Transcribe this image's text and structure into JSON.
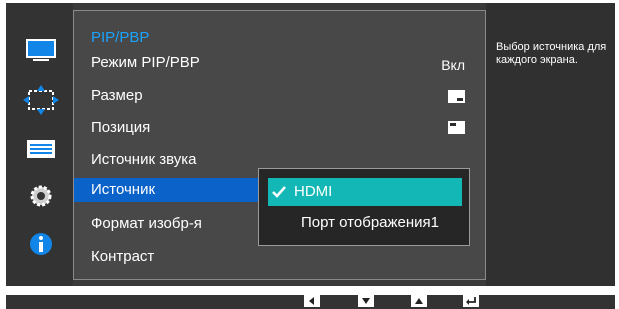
{
  "menu": {
    "title": "PIP/PBP",
    "items": [
      {
        "label": "Режим PIP/PBP"
      },
      {
        "label": "Размер"
      },
      {
        "label": "Позиция"
      },
      {
        "label": "Источник звука"
      },
      {
        "label": "Источник"
      },
      {
        "label": "Формат изобр-я"
      },
      {
        "label": "Контраст"
      }
    ],
    "mode_value": "Вкл"
  },
  "submenu": {
    "options": [
      {
        "label": "HDMI",
        "selected": true
      },
      {
        "label": "Порт отображения1",
        "selected": false
      }
    ]
  },
  "help": {
    "text": "Выбор источника для каждого экрана."
  },
  "sidebar": {
    "icons": [
      "picture-icon",
      "size-position-icon",
      "system-icon",
      "settings-icon",
      "information-icon"
    ]
  },
  "footer": {
    "buttons": [
      "left-arrow-icon",
      "down-arrow-icon",
      "up-arrow-icon",
      "enter-icon"
    ]
  },
  "colors": {
    "accent_blue": "#1aa3ff",
    "selected_row": "#0b62c8",
    "selected_option": "#13b8b6"
  }
}
